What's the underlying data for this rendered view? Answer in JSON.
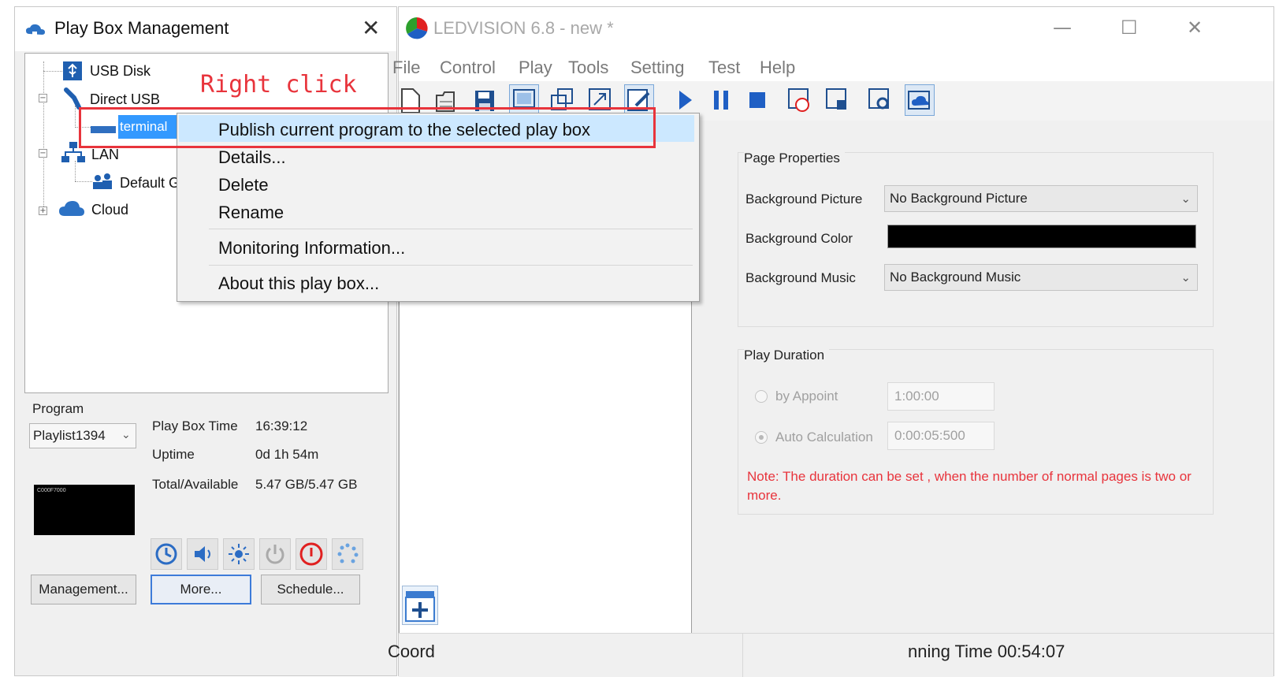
{
  "annotation": {
    "right_click_text": "Right click"
  },
  "playbox": {
    "title": "Play Box Management",
    "close_glyph": "✕",
    "tree": {
      "usb_disk": "USB Disk",
      "direct_usb": "Direct USB",
      "terminal": "terminal",
      "lan": "LAN",
      "default_group": "Default G",
      "cloud": "Cloud"
    },
    "program_label": "Program",
    "program_value": "Playlist1394",
    "preview_text": "C000F7000",
    "info": [
      {
        "label": "Play Box Time",
        "value": "16:39:12"
      },
      {
        "label": "Uptime",
        "value": "0d 1h 54m"
      },
      {
        "label": "Total/Available",
        "value": "5.47 GB/5.47 GB"
      }
    ],
    "icons": [
      "clock-icon",
      "volume-icon",
      "brightness-icon",
      "power-icon",
      "shutdown-icon",
      "loading-icon"
    ],
    "buttons": {
      "management": "Management...",
      "more": "More...",
      "schedule": "Schedule..."
    }
  },
  "ledvision": {
    "title": "LEDVISION 6.8 - new *",
    "controls": {
      "minimize": "—",
      "maximize": "☐",
      "close": "✕"
    },
    "menu": [
      "File",
      "Control",
      "Play",
      "Tools",
      "Setting",
      "Test",
      "Help"
    ],
    "page_properties": {
      "title": "Page Properties",
      "bg_picture_label": "Background Picture",
      "bg_picture_value": "No Background Picture",
      "bg_color_label": "Background Color",
      "bg_color_value": "#000000",
      "bg_music_label": "Background Music",
      "bg_music_value": "No Background Music"
    },
    "play_duration": {
      "title": "Play Duration",
      "by_appoint_label": "by Appoint",
      "by_appoint_value": "1:00:00",
      "auto_calc_label": "Auto Calculation",
      "auto_calc_value": "0:00:05:500",
      "note": "Note: The duration can be set , when the number of normal pages is two or more."
    },
    "status": {
      "coord": "Coord",
      "running": "nning Time 00:54:07"
    }
  },
  "context_menu": {
    "items": [
      "Publish current program to the selected play box",
      "Details...",
      "Delete",
      "Rename",
      "Monitoring Information...",
      "About this play box..."
    ]
  },
  "colors": {
    "highlight": "#cce8ff",
    "annotation_red": "#e8343c",
    "selection_blue": "#3399ff",
    "note_red": "#e8343c"
  }
}
